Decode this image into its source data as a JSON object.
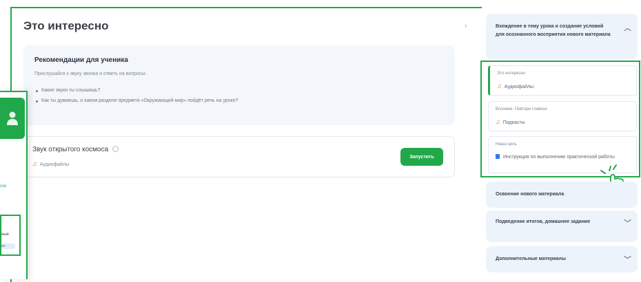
{
  "main": {
    "title": "Это интересно",
    "recommendations": {
      "title": "Рекомендации для ученика",
      "intro": "Прислушайся к звуку звонка и ответь на вопросы:",
      "questions": [
        "Какие звуки ты слышишь?",
        "Как ты думаешь, о каком разделе предмета «Окружающий мир» пойдёт речь на уроке?"
      ]
    },
    "sound_card": {
      "title": "Звук открытого космоса",
      "type": "Аудиофайлы",
      "launch_label": "Запустить"
    }
  },
  "sidebar": {
    "collapse_icon": "chevron-right-icon",
    "open_section": {
      "label": "Вхождение в тему урока и создание условий для осознанного восприятия нового материала",
      "icon": "chevron-up-icon",
      "items": [
        {
          "title": "Это интересно",
          "type": "Аудиофайлы",
          "icon": "note-icon"
        },
        {
          "title": "Вспомни. Повтори главное",
          "type": "Подкасты",
          "icon": "note-icon"
        },
        {
          "title": "Наша цель",
          "type": "Инструкция по выполнению практической работы",
          "icon": "doc-icon"
        }
      ]
    },
    "sections": [
      {
        "label": "Освоение нового материала"
      },
      {
        "label": "Подведение итогов, домашнее задание"
      },
      {
        "label": "Дополнительные материалы"
      }
    ]
  },
  "left_panel": {
    "link_fragment": "сок",
    "box_text": "ные",
    "chip_text": "ен"
  },
  "colors": {
    "accent": "#21a84a",
    "sidebar_bg": "#edf3fb",
    "audio": "#ef7a2c",
    "doc": "#3a78e8"
  }
}
